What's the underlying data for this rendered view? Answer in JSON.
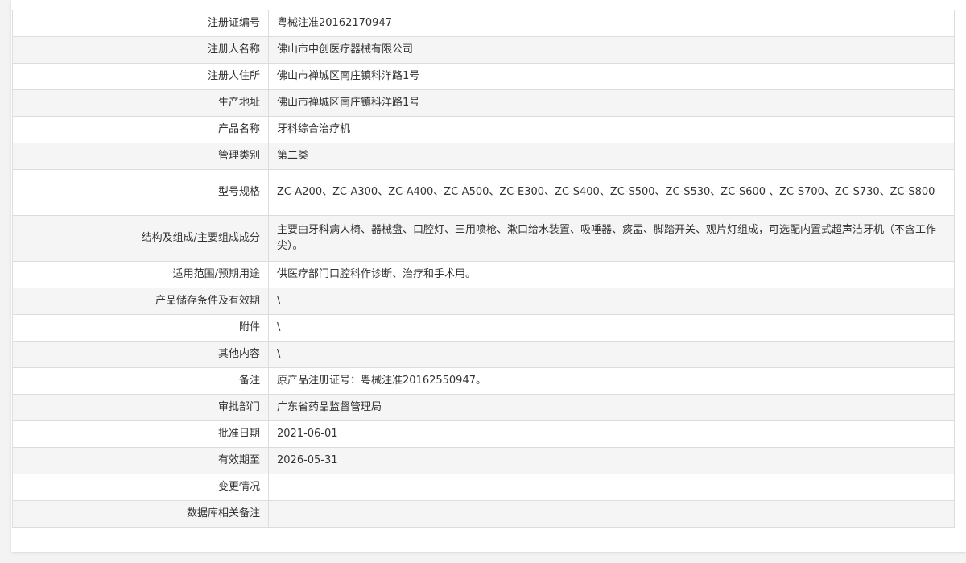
{
  "rows": [
    {
      "label": "注册证编号",
      "value": "粤械注准20162170947"
    },
    {
      "label": "注册人名称",
      "value": "佛山市中创医疗器械有限公司"
    },
    {
      "label": "注册人住所",
      "value": "佛山市禅城区南庄镇科洋路1号"
    },
    {
      "label": "生产地址",
      "value": "佛山市禅城区南庄镇科洋路1号"
    },
    {
      "label": "产品名称",
      "value": "牙科综合治疗机"
    },
    {
      "label": "管理类别",
      "value": "第二类"
    },
    {
      "label": "型号规格",
      "value": "ZC-A200、ZC-A300、ZC-A400、ZC-A500、ZC-E300、ZC-S400、ZC-S500、ZC-S530、ZC-S600 、ZC-S700、ZC-S730、ZC-S800"
    },
    {
      "label": "结构及组成/主要组成成分",
      "value": "主要由牙科病人椅、器械盘、口腔灯、三用喷枪、漱口给水装置、吸唾器、痰盂、脚踏开关、观片灯组成，可选配内置式超声洁牙机（不含工作尖）。"
    },
    {
      "label": "适用范围/预期用途",
      "value": "供医疗部门口腔科作诊断、治疗和手术用。"
    },
    {
      "label": "产品储存条件及有效期",
      "value": "\\"
    },
    {
      "label": "附件",
      "value": "\\"
    },
    {
      "label": "其他内容",
      "value": "\\"
    },
    {
      "label": "备注",
      "value": "原产品注册证号：粤械注准20162550947。"
    },
    {
      "label": "审批部门",
      "value": "广东省药品监督管理局"
    },
    {
      "label": "批准日期",
      "value": "2021-06-01"
    },
    {
      "label": "有效期至",
      "value": "2026-05-31"
    },
    {
      "label": "变更情况",
      "value": ""
    },
    {
      "label": "数据库相关备注",
      "value": ""
    }
  ]
}
